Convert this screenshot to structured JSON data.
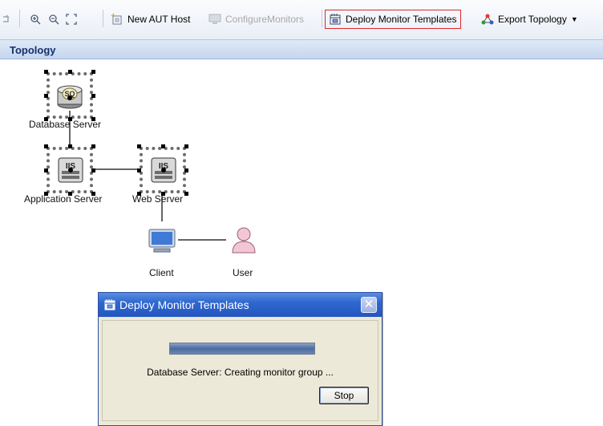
{
  "toolbar": {
    "new_aut_host": "New AUT Host",
    "configure_monitors": "ConfigureMonitors",
    "deploy_monitor_templates": "Deploy Monitor Templates",
    "export_topology": "Export Topology"
  },
  "panel": {
    "title": "Topology"
  },
  "topology": {
    "nodes": [
      {
        "label": "Database Server",
        "icon": "database-server-icon"
      },
      {
        "label": "Application Server",
        "icon": "iis-server-icon"
      },
      {
        "label": "Web Server",
        "icon": "iis-server-icon"
      },
      {
        "label": "Client",
        "icon": "computer-icon"
      },
      {
        "label": "User",
        "icon": "user-icon"
      }
    ]
  },
  "dialog": {
    "title": "Deploy Monitor Templates",
    "status": "Database Server: Creating monitor group ...",
    "progress": 1.0,
    "stop_label": "Stop"
  },
  "colors": {
    "highlight": "#e0262d",
    "dialog_title": "#2f67cf"
  }
}
